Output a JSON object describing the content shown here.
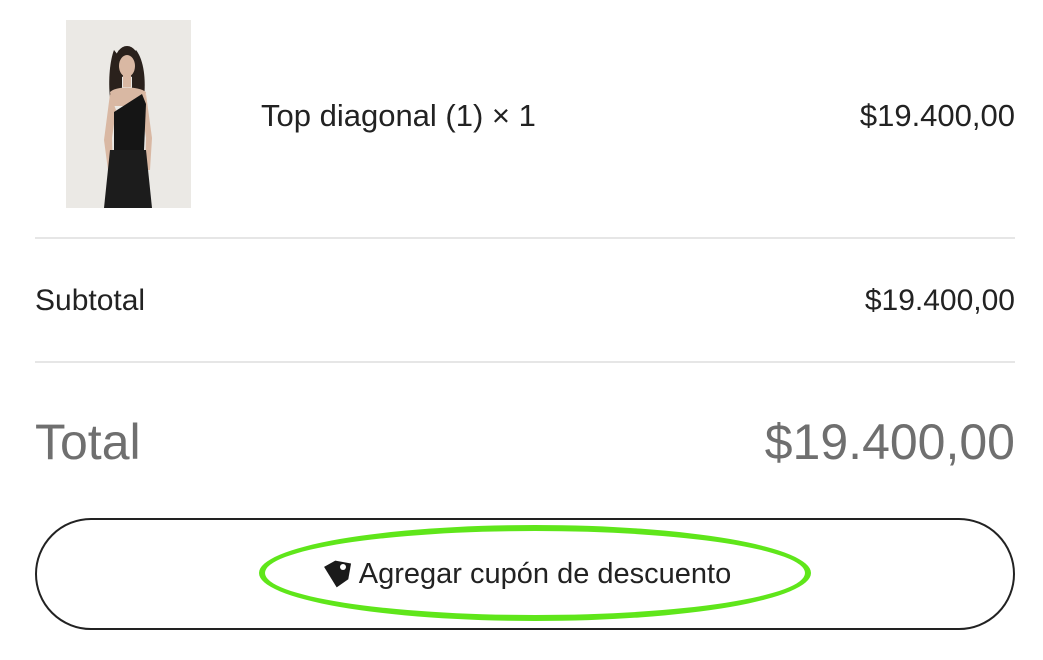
{
  "cart": {
    "item": {
      "name": "Top diagonal (1) × 1",
      "price": "$19.400,00",
      "thumbnail_icon": "product-photo"
    },
    "subtotal": {
      "label": "Subtotal",
      "value": "$19.400,00"
    },
    "total": {
      "label": "Total",
      "value": "$19.400,00"
    },
    "coupon": {
      "label": "Agregar cupón de descuento",
      "icon": "tag-icon"
    }
  },
  "colors": {
    "highlight": "#5fe61a",
    "text": "#222222",
    "total_text": "#6f6f6f",
    "divider": "#e6e6e6"
  }
}
